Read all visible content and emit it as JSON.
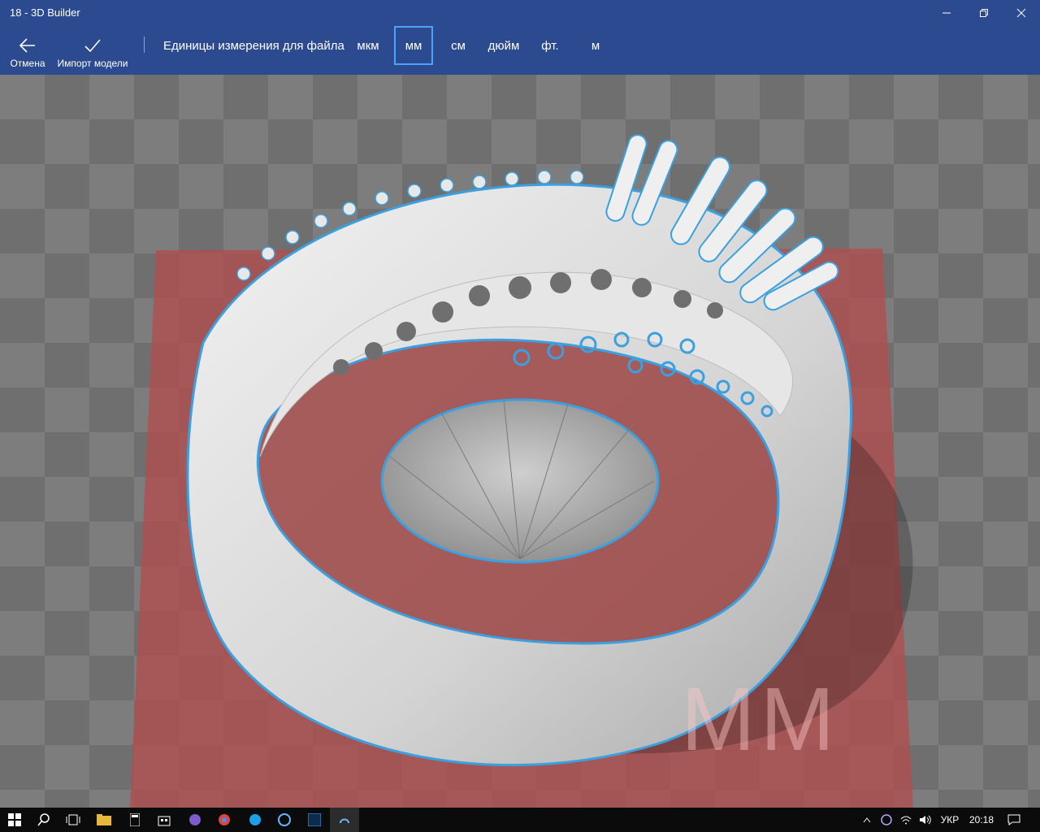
{
  "window": {
    "title": "18 - 3D Builder"
  },
  "toolbar": {
    "cancel_label": "Отмена",
    "import_label": "Импорт модели",
    "units_label": "Единицы измерения для файла",
    "units": [
      "мкм",
      "мм",
      "см",
      "дюйм",
      "фт.",
      "м"
    ],
    "selected_unit": "мм"
  },
  "viewport": {
    "floor_unit_label": "MM",
    "selection_color": "#3aa0e0",
    "floor_color": "#b24e4e"
  },
  "taskbar": {
    "apps": [
      "start-icon",
      "search-icon",
      "task-view-icon",
      "file-explorer-icon",
      "calculator-icon",
      "store-icon",
      "viber-icon",
      "chrome-icon",
      "skype-icon",
      "app-icon",
      "photoshop-icon",
      "3d-builder-icon"
    ],
    "language": "УКР",
    "time": "20:18"
  }
}
